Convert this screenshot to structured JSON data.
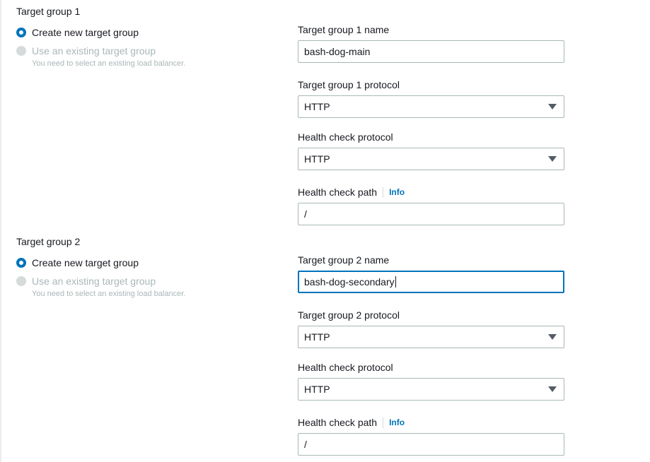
{
  "groups": [
    {
      "title": "Target group 1",
      "radio_create": "Create new target group",
      "radio_existing": "Use an existing target group",
      "existing_hint": "You need to select an existing load balancer.",
      "name_label": "Target group 1 name",
      "name_value": "bash-dog-main",
      "protocol_label": "Target group 1 protocol",
      "protocol_value": "HTTP",
      "hc_protocol_label": "Health check protocol",
      "hc_protocol_value": "HTTP",
      "hc_path_label": "Health check path",
      "hc_path_info": "Info",
      "hc_path_value": "/"
    },
    {
      "title": "Target group 2",
      "radio_create": "Create new target group",
      "radio_existing": "Use an existing target group",
      "existing_hint": "You need to select an existing load balancer.",
      "name_label": "Target group 2 name",
      "name_value": "bash-dog-secondary",
      "protocol_label": "Target group 2 protocol",
      "protocol_value": "HTTP",
      "hc_protocol_label": "Health check protocol",
      "hc_protocol_value": "HTTP",
      "hc_path_label": "Health check path",
      "hc_path_info": "Info",
      "hc_path_value": "/"
    }
  ],
  "colors": {
    "accent": "#0073bb",
    "disabled": "#aab7b8",
    "border": "#aab7b8",
    "text": "#16191f"
  },
  "icons": {
    "dropdown": "caret-down-icon",
    "radio_selected": "radio-selected-icon",
    "radio_disabled": "radio-disabled-icon"
  }
}
